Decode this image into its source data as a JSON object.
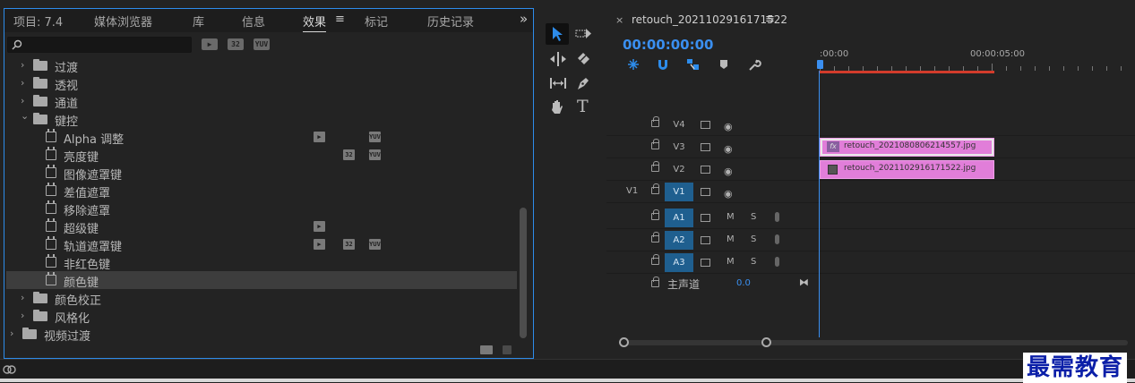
{
  "effects_panel": {
    "tabs": [
      {
        "label": "项目: 7.4",
        "active": false
      },
      {
        "label": "媒体浏览器",
        "active": false
      },
      {
        "label": "库",
        "active": false
      },
      {
        "label": "信息",
        "active": false
      },
      {
        "label": "效果",
        "active": true
      },
      {
        "label": "标记",
        "active": false
      },
      {
        "label": "历史记录",
        "active": false
      }
    ],
    "menu_glyph": "≡",
    "overflow_glyph": "»",
    "search": {
      "placeholder": "",
      "value": ""
    },
    "filter_badges": [
      "32",
      "YUV"
    ],
    "tree": [
      {
        "label": "过渡",
        "type": "folder",
        "expanded": false
      },
      {
        "label": "透视",
        "type": "folder",
        "expanded": false
      },
      {
        "label": "通道",
        "type": "folder",
        "expanded": false
      },
      {
        "label": "键控",
        "type": "folder",
        "expanded": true
      },
      {
        "label": "Alpha 调整",
        "type": "effect",
        "badges": [
          "accel",
          "yuv"
        ]
      },
      {
        "label": "亮度键",
        "type": "effect",
        "badges": [
          "32",
          "yuv"
        ]
      },
      {
        "label": "图像遮罩键",
        "type": "effect",
        "badges": []
      },
      {
        "label": "差值遮罩",
        "type": "effect",
        "badges": []
      },
      {
        "label": "移除遮罩",
        "type": "effect",
        "badges": []
      },
      {
        "label": "超级键",
        "type": "effect",
        "badges": [
          "accel"
        ]
      },
      {
        "label": "轨道遮罩键",
        "type": "effect",
        "badges": [
          "accel",
          "32",
          "yuv"
        ]
      },
      {
        "label": "非红色键",
        "type": "effect",
        "badges": []
      },
      {
        "label": "颜色键",
        "type": "effect",
        "badges": [],
        "selected": true
      },
      {
        "label": "颜色校正",
        "type": "folder",
        "expanded": false
      },
      {
        "label": "风格化",
        "type": "folder",
        "expanded": false
      },
      {
        "label": "视频过渡",
        "type": "folder",
        "expanded": false,
        "root": true
      }
    ],
    "badge_text": {
      "32": "32",
      "yuv": "YUV",
      "accel": "▶"
    }
  },
  "tools": [
    "selection-tool",
    "track-select-tool",
    "ripple-edit-tool",
    "razor-tool",
    "slip-tool",
    "pen-tool",
    "hand-tool",
    "type-tool"
  ],
  "type_tool_glyph": "T",
  "timeline": {
    "close_glyph": "×",
    "sequence_name": "retouch_2021102916171522",
    "menu_glyph": "≡",
    "timecode": "00:00:00:00",
    "ruler_labels": [
      ":00:00",
      "00:00:05:00"
    ],
    "tracks": [
      {
        "name": "V4",
        "kind": "video",
        "targeted": false,
        "source": ""
      },
      {
        "name": "V3",
        "kind": "video",
        "targeted": false,
        "source": "",
        "clip": "retouch_2021080806214557.jpg",
        "clip_fx": true
      },
      {
        "name": "V2",
        "kind": "video",
        "targeted": false,
        "source": "",
        "clip": "retouch_2021102916171522.jpg",
        "clip_fx": false
      },
      {
        "name": "V1",
        "kind": "video",
        "targeted": true,
        "source": "V1"
      },
      {
        "name": "A1",
        "kind": "audio",
        "targeted": true,
        "source": ""
      },
      {
        "name": "A2",
        "kind": "audio",
        "targeted": true,
        "source": ""
      },
      {
        "name": "A3",
        "kind": "audio",
        "targeted": true,
        "source": ""
      }
    ],
    "mute_label": "M",
    "solo_label": "S",
    "fx_label": "fx",
    "master": {
      "label": "主声道",
      "value": "0.0"
    }
  },
  "watermark": "最需教育",
  "colors": {
    "accent": "#2d8ceb",
    "timecode": "#3a8ff0",
    "clip": "#e17ed9",
    "work_area": "#d23b2b",
    "target": "#1f5f8f"
  }
}
